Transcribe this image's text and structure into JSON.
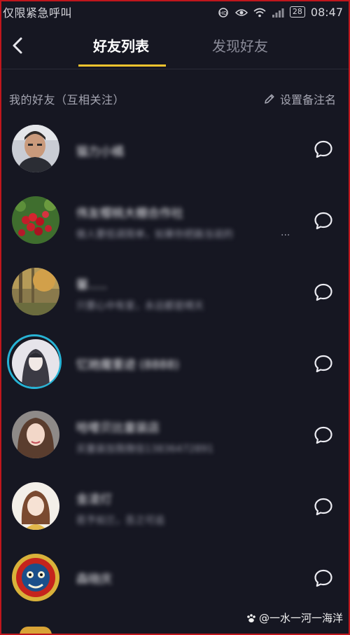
{
  "status_bar": {
    "carrier": "仅限紧急呼叫",
    "battery": "28",
    "time": "08:47"
  },
  "header": {
    "tabs": [
      {
        "label": "好友列表",
        "active": true
      },
      {
        "label": "发现好友",
        "active": false
      }
    ],
    "accent": "#f5c42e"
  },
  "section": {
    "title": "我的好友（互相关注）",
    "set_remark": "设置备注名"
  },
  "friends": [
    {
      "name": "猫力小橘",
      "subtitle": ""
    },
    {
      "name": "伟友樱桃大棚合作社",
      "subtitle": "做人要低调简单，如果你把路当说的",
      "truncated": true
    },
    {
      "name": "馨.....",
      "subtitle": "只要心中有爱，永远都是晴天"
    },
    {
      "name": "忆她魔重迹 (8888)",
      "subtitle": "",
      "highlighted": true
    },
    {
      "name": "哈喽贝比童装店",
      "subtitle": "买童装加我微信13836472891"
    },
    {
      "name": "金凌灯",
      "subtitle": "若予如兰，吾之可追"
    },
    {
      "name": "森晓庆",
      "subtitle": ""
    }
  ],
  "watermark": "@一水一河一海洋",
  "colors": {
    "background": "#161722",
    "highlight_ring": "#27b3d5",
    "frame": "#c0161c"
  }
}
